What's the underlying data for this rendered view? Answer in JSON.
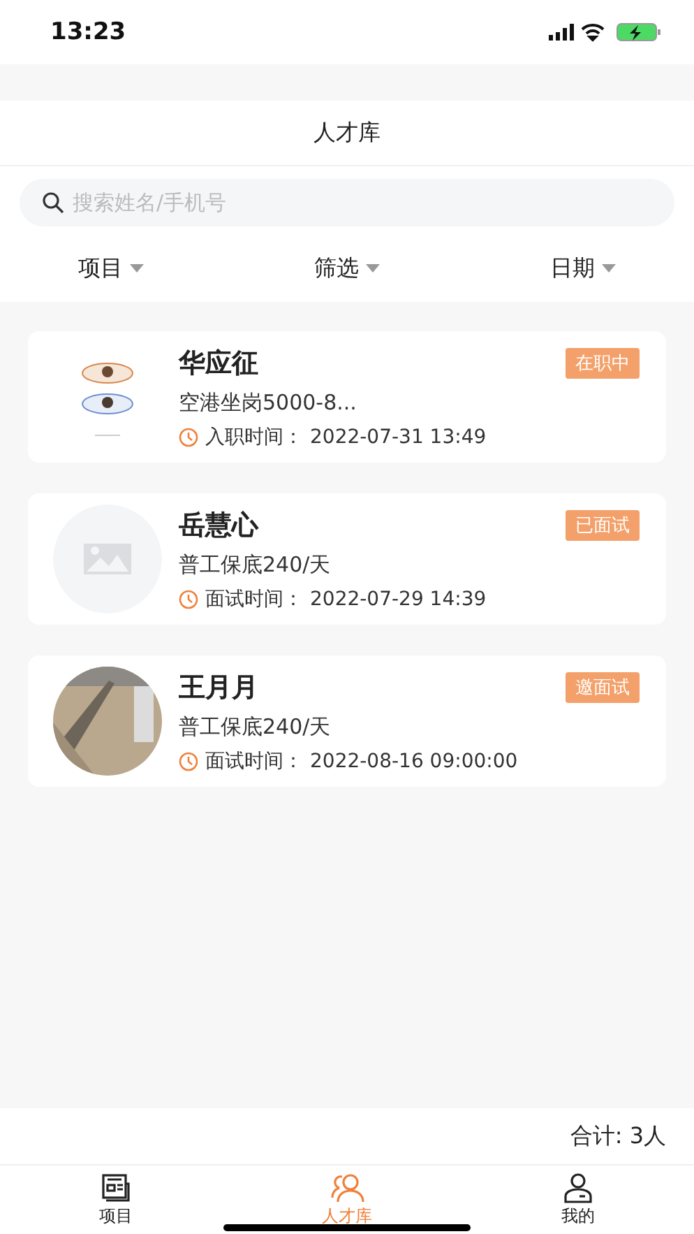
{
  "status_bar": {
    "time": "13:23"
  },
  "header": {
    "title": "人才库"
  },
  "search": {
    "placeholder": "搜索姓名/手机号"
  },
  "filters": [
    {
      "label": "项目"
    },
    {
      "label": "筛选"
    },
    {
      "label": "日期"
    }
  ],
  "candidates": [
    {
      "name": "华应征",
      "status": "在职中",
      "job": "空港坐岗5000-8...",
      "time_label": "入职时间：",
      "time": "2022-07-31 13:49"
    },
    {
      "name": "岳慧心",
      "avatar": {
        "kind": "placeholder"
      },
      "status": "已面试",
      "job": "普工保底240/天",
      "time_label": "面试时间：",
      "time": "2022-07-29 14:39"
    },
    {
      "name": "王月月",
      "status": "邀面试",
      "job": "普工保底240/天",
      "time_label": "面试时间：",
      "time": "2022-08-16 09:00:00"
    }
  ],
  "total": "合计: 3人",
  "tab_bar": [
    {
      "label": "项目",
      "kind": "newspaper",
      "selected": false
    },
    {
      "label": "人才库",
      "kind": "people",
      "selected": true
    },
    {
      "label": "我的",
      "kind": "person",
      "selected": false
    }
  ]
}
